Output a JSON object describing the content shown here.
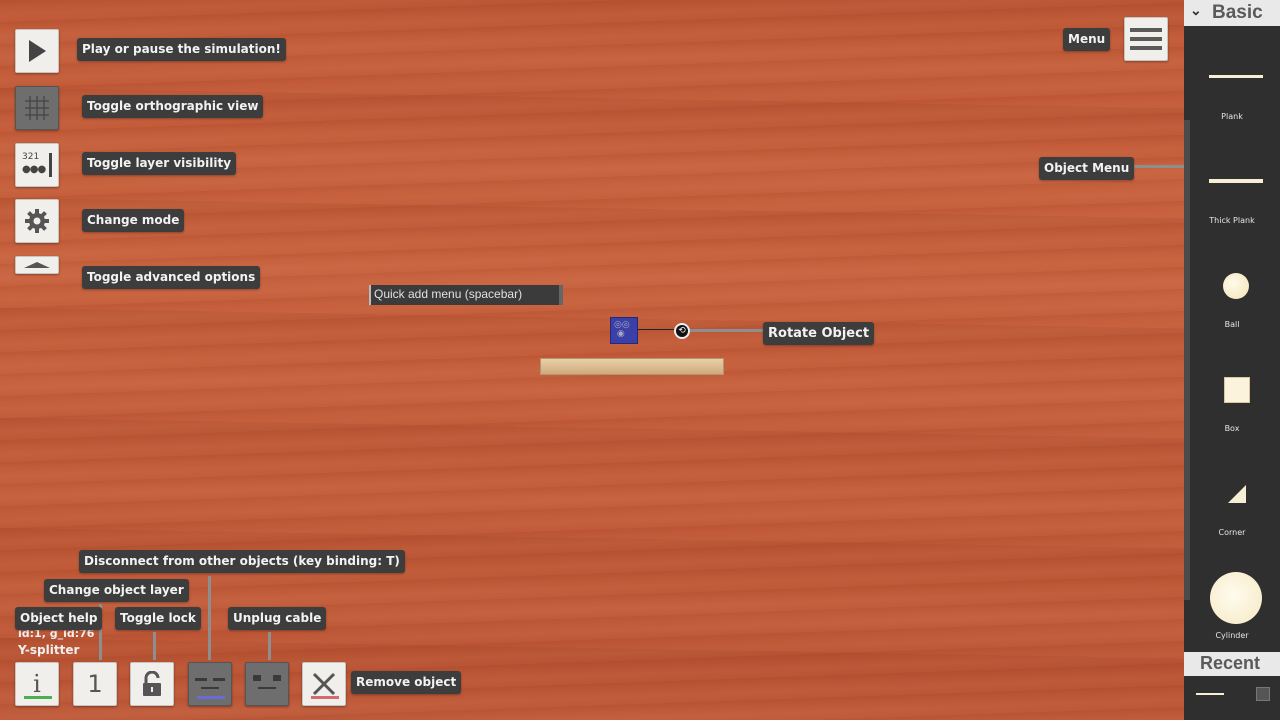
{
  "left_toolbar": {
    "play": {
      "tooltip": "Play or pause the simulation!",
      "icon": "play-icon"
    },
    "ortho": {
      "tooltip": "Toggle orthographic view",
      "icon": "grid-icon"
    },
    "layers": {
      "tooltip": "Toggle layer visibility",
      "icon": "layers-icon",
      "glyph": "321"
    },
    "mode": {
      "tooltip": "Change mode",
      "icon": "gear-icon"
    },
    "advanced": {
      "tooltip": "Toggle advanced options",
      "icon": "chevron-up-icon"
    }
  },
  "top_right": {
    "menu_tooltip": "Menu",
    "menu_icon": "hamburger-icon",
    "object_menu_tooltip": "Object Menu"
  },
  "canvas": {
    "quick_add_placeholder": "Quick add menu (spacebar)",
    "rotate_tooltip": "Rotate Object",
    "rotate_icon": "rotate-icon"
  },
  "selection_info": {
    "id_line": "id:1, g_id:76",
    "name": "Y-splitter"
  },
  "bottom_toolbar": {
    "help": {
      "tooltip": "Object help",
      "glyph": "i",
      "icon": "info-icon",
      "accent": "#4caf50"
    },
    "layer": {
      "tooltip": "Change object layer",
      "glyph": "1"
    },
    "lock": {
      "tooltip": "Toggle lock",
      "icon": "unlock-icon"
    },
    "disconnect": {
      "tooltip": "Disconnect from other objects (key binding: T)",
      "icon": "disconnect-icon",
      "accent": "#6b6bd6"
    },
    "unplug": {
      "tooltip": "Unplug cable",
      "icon": "unplug-icon"
    },
    "remove": {
      "tooltip": "Remove object",
      "icon": "close-icon",
      "accent": "#d46a6a"
    }
  },
  "panel": {
    "basic_header": "Basic",
    "recent_header": "Recent",
    "items": [
      {
        "label": "Plank",
        "icon": "plank-icon"
      },
      {
        "label": "Thick Plank",
        "icon": "thick-plank-icon"
      },
      {
        "label": "Ball",
        "icon": "ball-icon"
      },
      {
        "label": "Box",
        "icon": "box-icon"
      },
      {
        "label": "Corner",
        "icon": "corner-icon"
      },
      {
        "label": "Cylinder",
        "icon": "cylinder-icon"
      }
    ]
  }
}
